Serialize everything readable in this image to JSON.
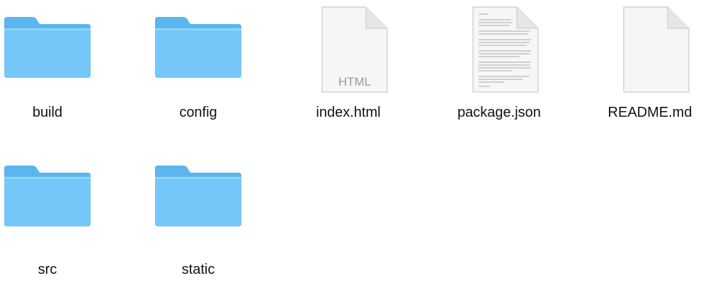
{
  "window": {
    "view": "Finder icon view"
  },
  "colors": {
    "folder_body": "#6ec4f6",
    "folder_tab": "#5bb6ee",
    "document_paper": "#f7f7f7",
    "document_border": "#d6d6d6"
  },
  "items": [
    {
      "label": "build",
      "icon": "folder-icon"
    },
    {
      "label": "config",
      "icon": "folder-icon"
    },
    {
      "label": "index.html",
      "icon": "html-file-icon",
      "badge": "HTML"
    },
    {
      "label": "package.json",
      "icon": "text-document-icon"
    },
    {
      "label": "README.md",
      "icon": "blank-document-icon"
    },
    {
      "label": "src",
      "icon": "folder-icon"
    },
    {
      "label": "static",
      "icon": "folder-icon"
    }
  ]
}
